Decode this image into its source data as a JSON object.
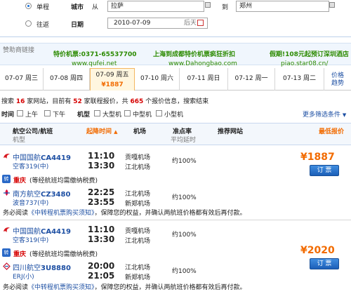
{
  "search_form": {
    "trip_types": [
      "单程",
      "往返"
    ],
    "city_label": "城市",
    "from_label": "从",
    "from_value": "拉萨",
    "to_label": "到",
    "to_value": "郑州",
    "date_label": "日期",
    "date_value": "2010-07-09",
    "date_weekday": "后天"
  },
  "ads": {
    "label": "赞助商链接",
    "items": [
      {
        "title": "特价机票:0371-65537700",
        "url": "www.qufei.net"
      },
      {
        "title": "上海到成都特价机票疯狂折扣",
        "url": "www.Dahongbao.com"
      },
      {
        "title": "假期!108元起预订深圳酒店",
        "url": "piao.star08.cn/"
      }
    ]
  },
  "date_tabs": [
    {
      "label": "07-07 周三"
    },
    {
      "label": "07-08 周四"
    },
    {
      "label": "07-09 周五",
      "price": "¥1887",
      "active": true
    },
    {
      "label": "07-10 周六"
    },
    {
      "label": "07-11 周日"
    },
    {
      "label": "07-12 周一"
    },
    {
      "label": "07-13 周二"
    }
  ],
  "price_trend": "价格\n趋势",
  "summary": {
    "p1": "搜索",
    "sites": "16",
    "p2": "家网站，目前有",
    "airlines": "52",
    "p3": "家联程报价，共",
    "quotes": "665",
    "p4": "个报价信息，搜索结束"
  },
  "filters": {
    "time_label": "时间",
    "times": [
      "上午",
      "下午"
    ],
    "type_label": "机型",
    "types": [
      "大型机",
      "中型机",
      "小型机"
    ],
    "more": "更多筛选条件"
  },
  "table_header": {
    "airline": "航空公司/航班",
    "plane": "机型",
    "dep_time": "起降时间",
    "airport": "机场",
    "ontime": "准点率",
    "delay": "平均延时",
    "site": "推荐网站",
    "price": "最低报价"
  },
  "results": [
    {
      "leg1": {
        "airline": "中国国航",
        "flight": "CA4419",
        "plane": "空客319(中)",
        "dep": "11:10",
        "arr": "13:30",
        "apt1": "贡嘎机场",
        "apt2": "江北机场",
        "ontime": "约100%"
      },
      "transfer_city": "重庆",
      "transfer_note": "(等经航班均需缴纳税费)",
      "leg2": {
        "airline": "南方航空",
        "flight": "CZ3480",
        "plane": "波音737(中)",
        "dep": "22:25",
        "arr": "23:55",
        "apt1": "江北机场",
        "apt2": "新郑机场",
        "ontime": "约100%"
      },
      "note_pre": "务必阅读",
      "note_link": "《中转程机票购买须知》",
      "note_post": "，保障您的权益，并确认两航班价格都有效后再付款。",
      "price": "¥1887",
      "book": "订 票"
    },
    {
      "leg1": {
        "airline": "中国国航",
        "flight": "CA4419",
        "plane": "空客319(中)",
        "dep": "11:10",
        "arr": "13:30",
        "apt1": "贡嘎机场",
        "apt2": "江北机场",
        "ontime": "约100%"
      },
      "transfer_city": "重庆",
      "transfer_note": "(等经航班均需缴纳税费)",
      "leg2": {
        "airline": "四川航空",
        "flight": "3U8880",
        "plane": "ERJ(小)",
        "dep": "20:00",
        "arr": "21:05",
        "apt1": "江北机场",
        "apt2": "新郑机场",
        "ontime": "约100%"
      },
      "note_pre": "务必阅读",
      "note_link": "《中转程机票购买须知》",
      "note_post": "，保障您的权益，并确认两航班价格都有效后再付款。",
      "price": "¥2020",
      "book": "订 票"
    }
  ]
}
